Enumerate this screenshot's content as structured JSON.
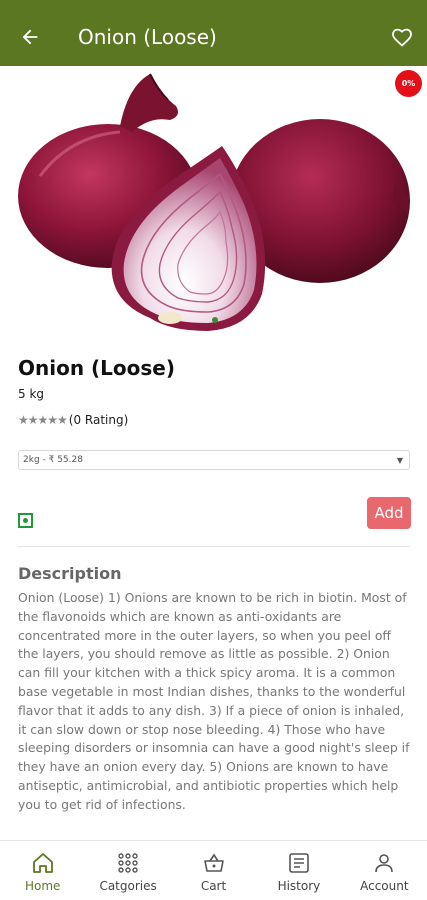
{
  "app_bar": {
    "title": "Onion (Loose)",
    "back_icon": "arrow-left-icon",
    "favorite_icon": "heart-outline-icon",
    "color": "#5b7722"
  },
  "product": {
    "discount_badge": "0%",
    "name": "Onion (Loose)",
    "quantity": "5 kg",
    "rating_stars": "★★★★★",
    "rating_text": "(0 Rating)",
    "rating_value": 0,
    "variant_selected": "2kg - ₹ 55.28",
    "veg_icon": "veg-indicator-icon",
    "add_label": "Add"
  },
  "description": {
    "title": "Description",
    "body": "Onion (Loose) 1) Onions are known to be rich in biotin. Most of the flavonoids which are known as anti-oxidants are concentrated more in the outer layers, so when you peel off the layers, you should remove as little as possible. 2) Onion can fill your kitchen with a thick spicy aroma. It is a common base vegetable in most Indian dishes, thanks to the wonderful flavor that it adds to any dish. 3) If a piece of onion is inhaled, it can slow down or stop nose bleeding. 4) Those who have sleeping disorders or insomnia can have a good night's sleep if they have an onion every day. 5) Onions are known to have antiseptic, antimicrobial, and antibiotic properties which help you to get rid of infections."
  },
  "bottom_nav": {
    "items": [
      {
        "label": "Home",
        "icon": "home-icon",
        "active": true
      },
      {
        "label": "Catgories",
        "icon": "grid-icon",
        "active": false
      },
      {
        "label": "Cart",
        "icon": "basket-icon",
        "active": false
      },
      {
        "label": "History",
        "icon": "history-icon",
        "active": false
      },
      {
        "label": "Account",
        "icon": "person-icon",
        "active": false
      }
    ]
  }
}
